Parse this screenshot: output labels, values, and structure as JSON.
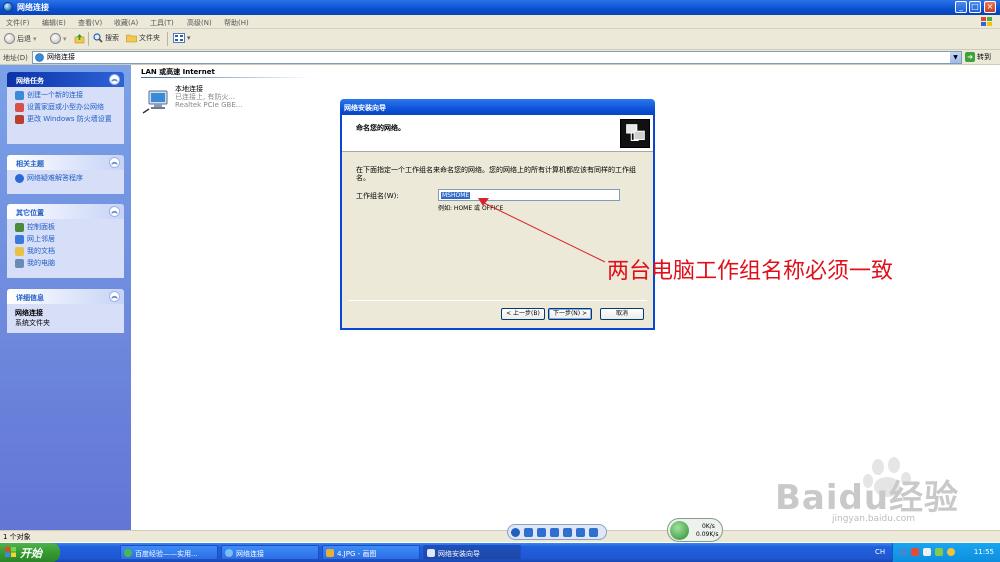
{
  "window": {
    "title": "网络连接",
    "controls": {
      "minimize": "_",
      "maximize": "□",
      "close": "×"
    }
  },
  "menu": [
    "文件(F)",
    "编辑(E)",
    "查看(V)",
    "收藏(A)",
    "工具(T)",
    "高级(N)",
    "帮助(H)"
  ],
  "toolbar": {
    "back": "后退",
    "search": "搜索",
    "folders": "文件夹"
  },
  "address": {
    "label": "地址(D)",
    "value": "网络连接",
    "go": "转到"
  },
  "left_panes": {
    "tasks": {
      "title": "网络任务",
      "items": [
        "创建一个新的连接",
        "设置家庭或小型办公网络",
        "更改 Windows 防火墙设置"
      ]
    },
    "related": {
      "title": "相关主题",
      "items": [
        "网络疑难解答程序"
      ]
    },
    "places": {
      "title": "其它位置",
      "items": [
        "控制面板",
        "网上邻居",
        "我的文档",
        "我的电脑"
      ]
    },
    "details": {
      "title": "详细信息",
      "name": "网络连接",
      "type": "系统文件夹"
    }
  },
  "content": {
    "group_header": "LAN 或高速 Internet",
    "connection": {
      "name": "本地连接",
      "status": "已连接上, 有防火...",
      "adapter": "Realtek PCIe GBE..."
    }
  },
  "wizard": {
    "title": "网络安装向导",
    "heading": "命名您的网络。",
    "description": "在下面指定一个工作组名来命名您的网络。您的网络上的所有计算机都应该有同样的工作组名。",
    "workgroup_label": "工作组名(W):",
    "workgroup_value": "MSHOME",
    "example": "例如: HOME 或 OFFICE",
    "buttons": {
      "back": "< 上一步(B)",
      "next": "下一步(N) >",
      "cancel": "取消"
    }
  },
  "annotation": "两台电脑工作组名称必须一致",
  "watermark": {
    "brand": "Baidu经验",
    "url": "jingyan.baidu.com"
  },
  "statusbar": "1 个对象",
  "netspeed": {
    "up": "0K/s",
    "down": "0.09K/s"
  },
  "taskbar": {
    "start": "开始",
    "tasks": [
      "百度经验——实用...",
      "网络连接",
      "4.JPG - 画图",
      "网络安装向导"
    ],
    "lang": "CH",
    "clock": "11:55"
  }
}
